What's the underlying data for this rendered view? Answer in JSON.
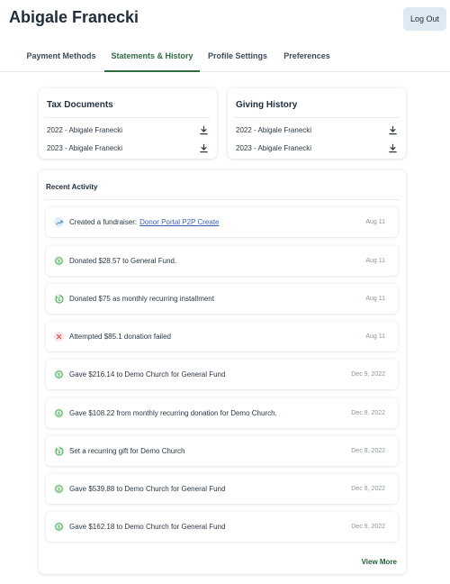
{
  "header": {
    "user_name": "Abigale Franecki",
    "logout_label": "Log Out"
  },
  "tabs": [
    {
      "label": "Payment Methods",
      "active": false
    },
    {
      "label": "Statements & History",
      "active": true
    },
    {
      "label": "Profile Settings",
      "active": false
    },
    {
      "label": "Preferences",
      "active": false
    }
  ],
  "tax_documents": {
    "title": "Tax Documents",
    "items": [
      {
        "label": "2022 - Abigale Franecki",
        "icon": "download-icon"
      },
      {
        "label": "2023 - Abigale Franecki",
        "icon": "download-icon"
      }
    ]
  },
  "giving_history": {
    "title": "Giving History",
    "items": [
      {
        "label": "2022 - Abigale Franecki",
        "icon": "download-icon"
      },
      {
        "label": "2023 - Abigale Franecki",
        "icon": "download-icon"
      }
    ]
  },
  "recent_activity": {
    "title": "Recent Activity",
    "items": [
      {
        "text": "Created a fundraiser:",
        "link": "Donor Portal P2P Create",
        "date": "Aug 11",
        "icon": "trend-up-icon"
      },
      {
        "text": "Donated $28.57 to General Fund.",
        "date": "Aug 11",
        "icon": "dollar-icon"
      },
      {
        "text": "Donated $75 as monthly recurring installment",
        "date": "Aug 11",
        "icon": "recurring-dollar-icon"
      },
      {
        "text": "Attempted $85.1 donation failed",
        "date": "Aug 11",
        "icon": "x-icon"
      },
      {
        "text": "Gave $216.14 to Demo Church for General Fund",
        "date": "Dec 9, 2022",
        "icon": "dollar-icon"
      },
      {
        "text": "Gave $108.22 from monthly recurring donation for Demo Church.",
        "date": "Dec 9, 2022",
        "icon": "dollar-icon"
      },
      {
        "text": "Set a recurring gift for Demo Church",
        "date": "Dec 9, 2022",
        "icon": "recurring-dollar-icon"
      },
      {
        "text": "Gave $539.88 to Demo Church for General Fund",
        "date": "Dec 9, 2022",
        "icon": "dollar-icon"
      },
      {
        "text": "Gave $162.18 to Demo Church for General Fund",
        "date": "Dec 9, 2022",
        "icon": "dollar-icon"
      }
    ],
    "view_more_label": "View More"
  },
  "colors": {
    "accent": "#2f6b3f",
    "success_icon": "#3fa34d",
    "error_icon": "#d9534f",
    "info_icon": "#4a90c9",
    "link": "#3c63b5"
  }
}
